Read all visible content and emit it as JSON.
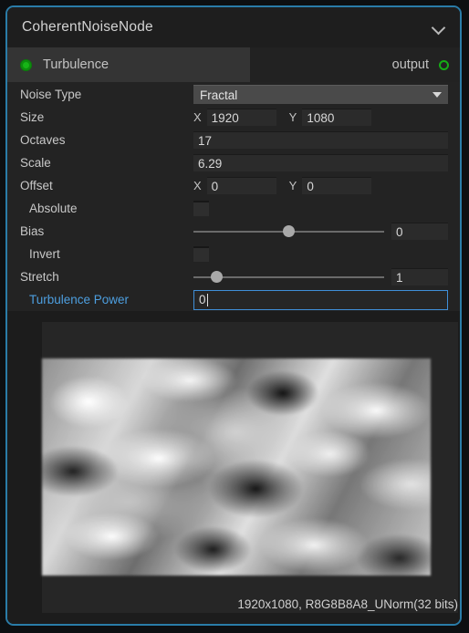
{
  "node": {
    "title": "CoherentNoiseNode",
    "collapse_icon": "chevron-down-icon"
  },
  "ports": {
    "input": {
      "label": "Turbulence",
      "icon": "port-connected-icon",
      "color": "#17b417"
    },
    "output": {
      "label": "output",
      "icon": "port-open-icon",
      "color": "#16ad16"
    }
  },
  "properties": {
    "noise_type": {
      "label": "Noise Type",
      "value": "Fractal",
      "caret_icon": "caret-down-icon"
    },
    "size": {
      "label": "Size",
      "x_axis": "X",
      "x_value": "1920",
      "y_axis": "Y",
      "y_value": "1080"
    },
    "octaves": {
      "label": "Octaves",
      "value": "17"
    },
    "scale": {
      "label": "Scale",
      "value": "6.29"
    },
    "offset": {
      "label": "Offset",
      "x_axis": "X",
      "x_value": "0",
      "y_axis": "Y",
      "y_value": "0"
    },
    "absolute": {
      "label": "Absolute",
      "checked": false
    },
    "bias": {
      "label": "Bias",
      "value": "0",
      "slider_percent": 50
    },
    "invert": {
      "label": "Invert",
      "checked": false
    },
    "stretch": {
      "label": "Stretch",
      "value": "1",
      "slider_percent": 12
    },
    "turbulence_power": {
      "label": "Turbulence Power",
      "value": "0",
      "focused": true
    }
  },
  "preview": {
    "status": "1920x1080, R8G8B8A8_UNorm(32 bits)"
  },
  "colors": {
    "border": "#2a7ca8",
    "accent_focus": "#3f8fd8",
    "active_label": "#4d9fe0",
    "panel": "#232323",
    "port_green": "#17b417"
  }
}
